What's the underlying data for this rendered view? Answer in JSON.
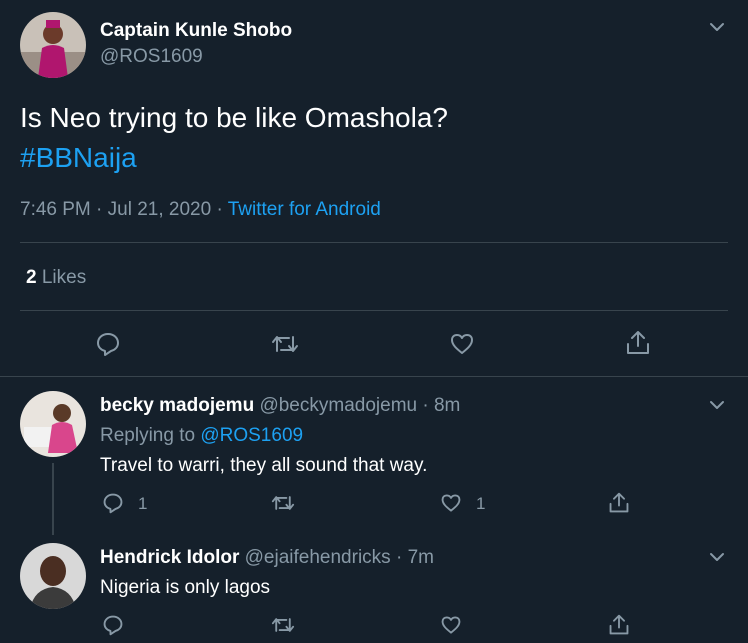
{
  "main_tweet": {
    "author_name": "Captain Kunle Shobo",
    "handle": "@ROS1609",
    "text": "Is Neo trying to be like Omashola?",
    "hashtag": "#BBNaija",
    "time": "7:46 PM",
    "separator": "·",
    "date": "Jul 21, 2020",
    "source": "Twitter for Android",
    "likes_count": "2",
    "likes_label": "Likes"
  },
  "replies": [
    {
      "author_name": "becky madojemu",
      "handle": "@beckymadojemu",
      "separator": "·",
      "age": "8m",
      "replying_prefix": "Replying to",
      "replying_to": "@ROS1609",
      "text": "Travel to warri, they all sound that way.",
      "reply_count": "1",
      "like_count": "1"
    },
    {
      "author_name": "Hendrick Idolor",
      "handle": "@ejaifehendricks",
      "separator": "·",
      "age": "7m",
      "text": "Nigeria is only lagos"
    }
  ],
  "colors": {
    "background": "#15202b",
    "text": "#ffffff",
    "muted": "#8899a6",
    "accent": "#1da1f2",
    "divider": "#38444d"
  },
  "icons": [
    "chevron-down-icon",
    "reply-icon",
    "retweet-icon",
    "like-icon",
    "share-icon"
  ]
}
